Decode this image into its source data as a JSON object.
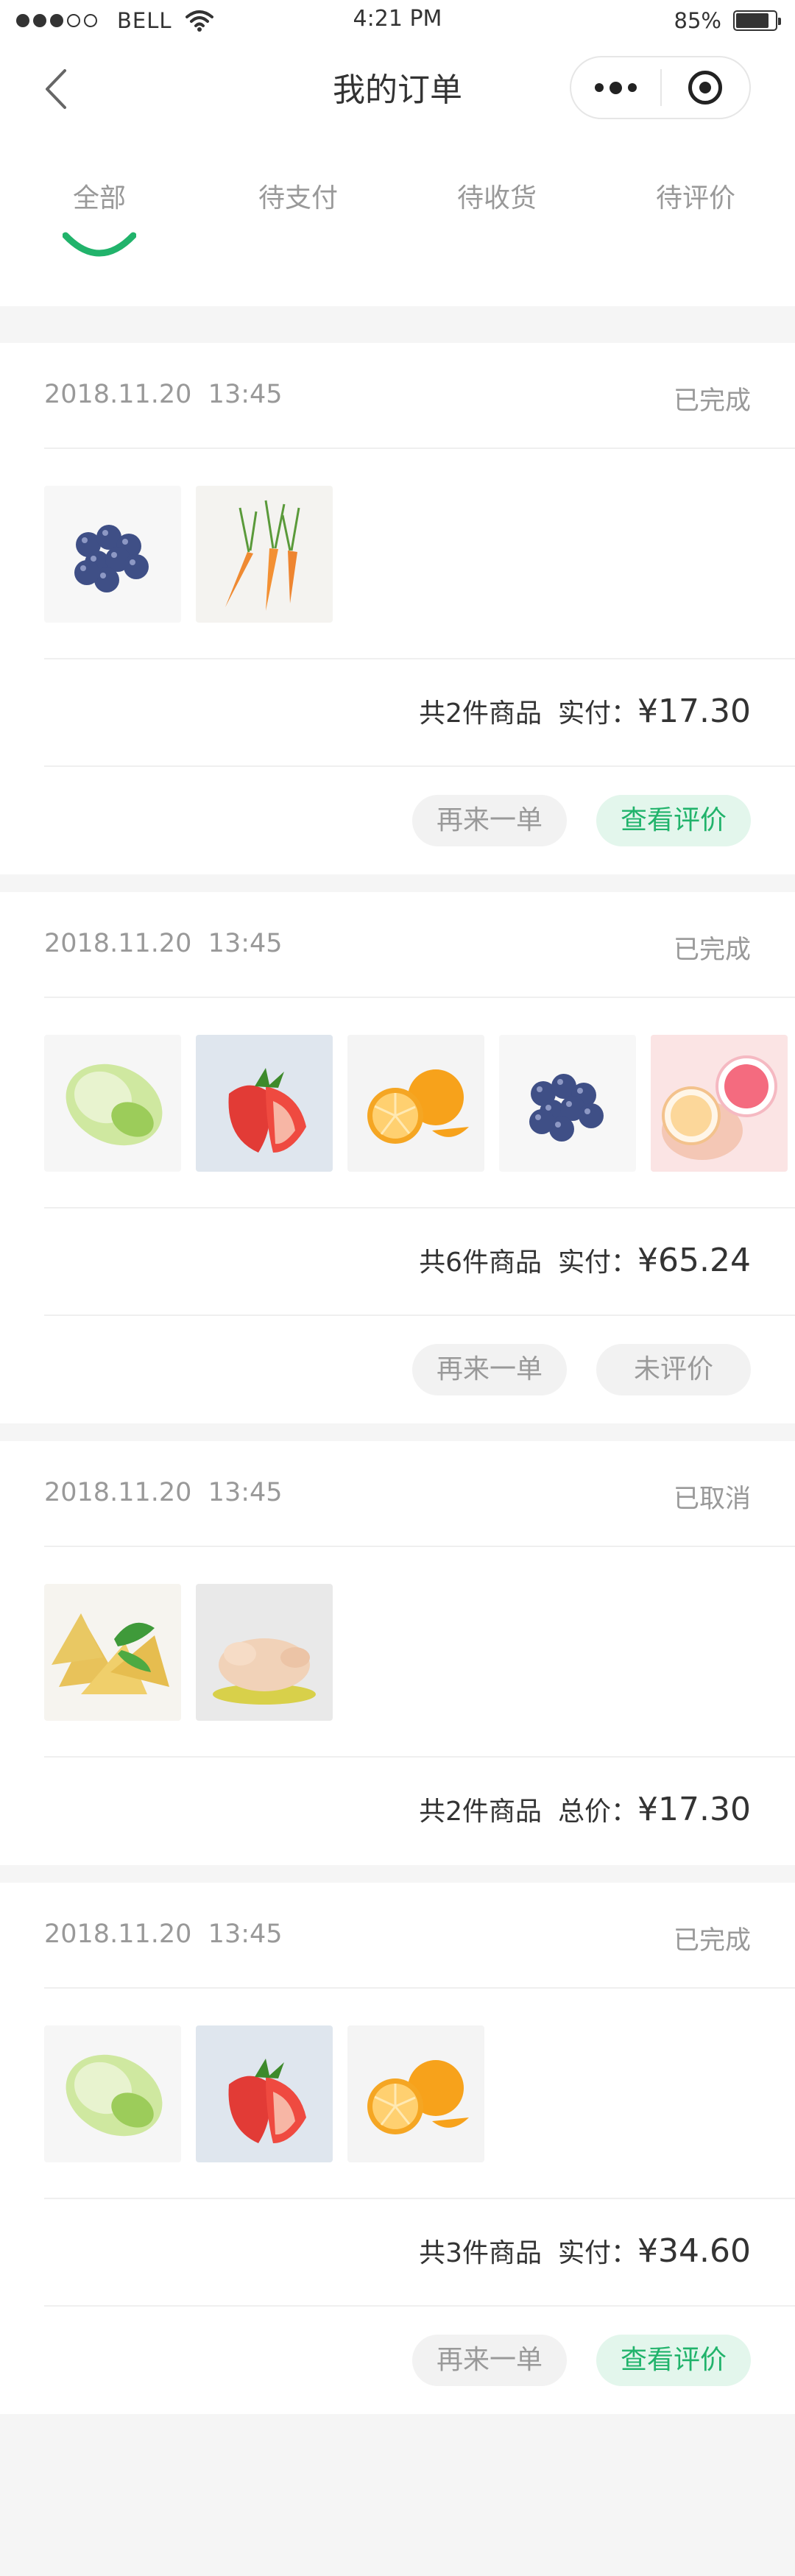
{
  "status_bar": {
    "carrier": "BELL",
    "time": "4:21 PM",
    "battery": "85%",
    "battery_level": 0.85
  },
  "nav": {
    "title": "我的订单"
  },
  "tabs": [
    {
      "label": "全部",
      "active": true
    },
    {
      "label": "待支付",
      "active": false
    },
    {
      "label": "待收货",
      "active": false
    },
    {
      "label": "待评价",
      "active": false
    }
  ],
  "colors": {
    "accent": "#21b36b",
    "accent_light": "#e3f6ec",
    "muted_text": "#999999",
    "background": "#f5f5f5"
  },
  "orders": [
    {
      "date": "2018.11.20",
      "time": "13:45",
      "status": "已完成",
      "items": [
        "blueberries",
        "carrots"
      ],
      "count_text": "共2件商品",
      "price_label": "实付：",
      "price": "¥17.30",
      "actions": [
        {
          "label": "再来一单",
          "style": "grey"
        },
        {
          "label": "查看评价",
          "style": "green"
        }
      ]
    },
    {
      "date": "2018.11.20",
      "time": "13:45",
      "status": "已完成",
      "items": [
        "cabbage",
        "strawberry",
        "orange",
        "blueberries",
        "jelly-cups"
      ],
      "count_text": "共6件商品",
      "price_label": "实付：",
      "price": "¥65.24",
      "actions": [
        {
          "label": "再来一单",
          "style": "grey"
        },
        {
          "label": "未评价",
          "style": "grey"
        }
      ]
    },
    {
      "date": "2018.11.20",
      "time": "13:45",
      "status": "已取消",
      "items": [
        "chips",
        "chicken"
      ],
      "count_text": "共2件商品",
      "price_label": "总价：",
      "price": "¥17.30",
      "actions": []
    },
    {
      "date": "2018.11.20",
      "time": "13:45",
      "status": "已完成",
      "items": [
        "cabbage",
        "strawberry",
        "orange"
      ],
      "count_text": "共3件商品",
      "price_label": "实付：",
      "price": "¥34.60",
      "actions": [
        {
          "label": "再来一单",
          "style": "grey"
        },
        {
          "label": "查看评价",
          "style": "green"
        }
      ]
    }
  ]
}
